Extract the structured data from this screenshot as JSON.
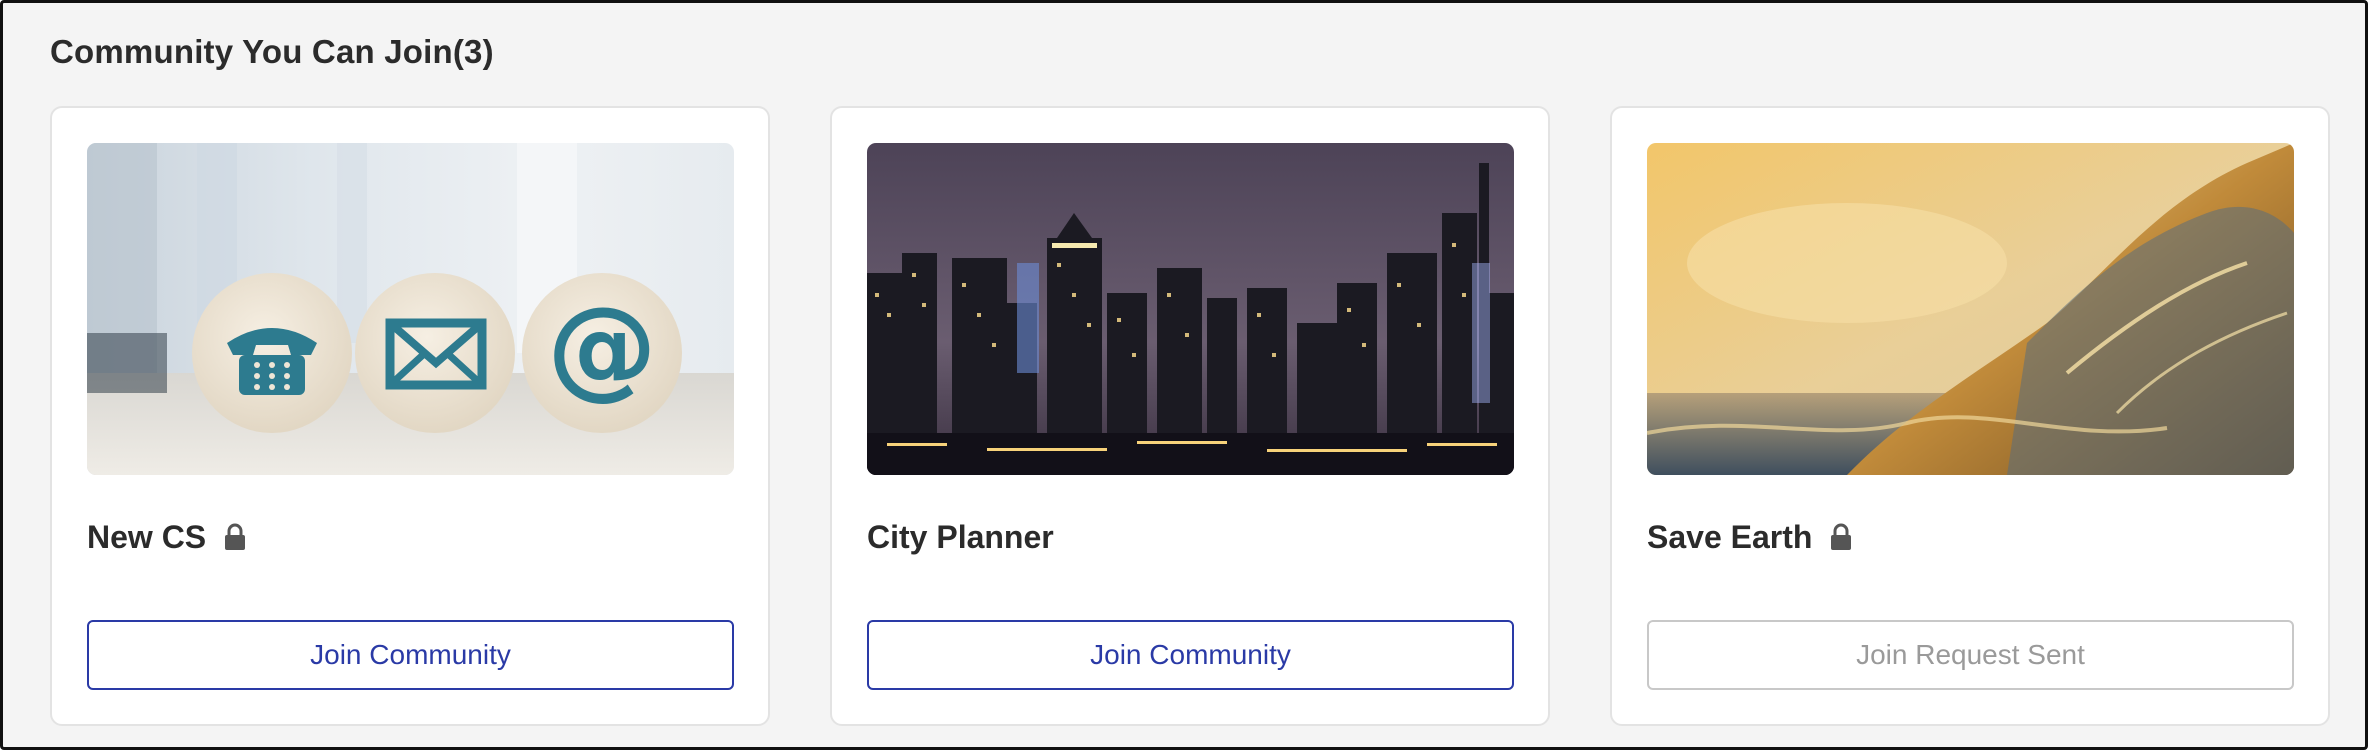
{
  "section": {
    "title": "Community You Can Join(3)"
  },
  "communities": [
    {
      "name": "New CS",
      "locked": true,
      "image_icon": "phone-mail-at-image",
      "button_label": "Join Community",
      "button_state": "join"
    },
    {
      "name": "City Planner",
      "locked": false,
      "image_icon": "city-skyline-image",
      "button_label": "Join Community",
      "button_state": "join"
    },
    {
      "name": "Save Earth",
      "locked": true,
      "image_icon": "ocean-wave-image",
      "button_label": "Join Request Sent",
      "button_state": "sent"
    }
  ],
  "colors": {
    "accent": "#2a3aa6",
    "disabled": "#9a9a9a",
    "background": "#f4f4f4"
  }
}
